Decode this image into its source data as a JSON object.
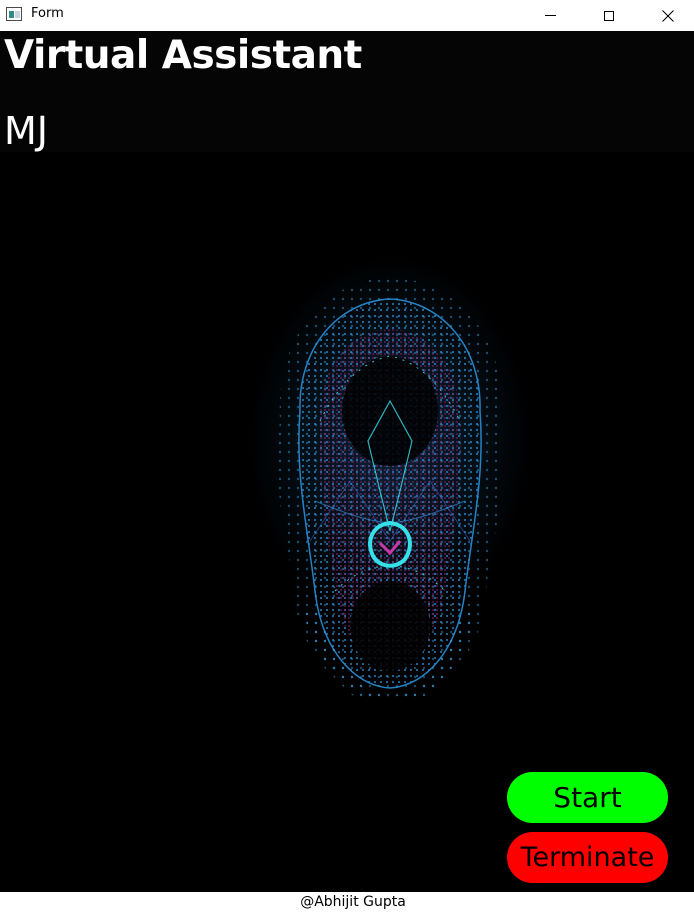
{
  "window": {
    "title": "Form",
    "icon": "form-app-icon",
    "controls": {
      "minimize": "minimize-icon",
      "maximize": "maximize-icon",
      "close": "close-icon"
    }
  },
  "header": {
    "heading": "Virtual Assistant",
    "assistant_name": "MJ"
  },
  "main": {
    "graphic": "particle-face-icon"
  },
  "actions": {
    "start_label": "Start",
    "start_color": "#00ff00",
    "terminate_label": "Terminate",
    "terminate_color": "#ff0000"
  },
  "footer": {
    "credit": "@Abhijit Gupta"
  },
  "colors": {
    "background": "#000000",
    "text": "#ffffff",
    "graphic_blue": "#2a8fd8",
    "graphic_cyan": "#36e0e8",
    "graphic_magenta": "#7a1f6a"
  }
}
